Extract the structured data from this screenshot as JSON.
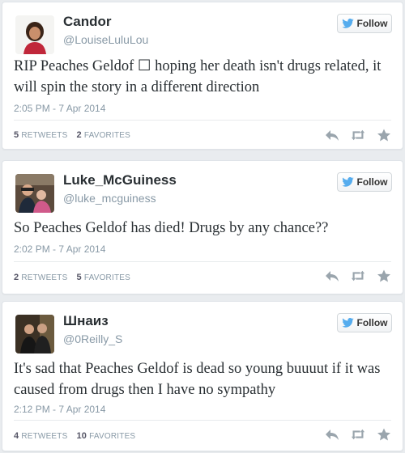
{
  "follow_label": "Follow",
  "stats_labels": {
    "retweets": "RETWEETS",
    "favorites": "FAVORITES"
  },
  "tweets": [
    {
      "display_name": "Candor",
      "screen_name": "@LouiseLuluLou",
      "text": "RIP Peaches Geldof ☐ hoping her death isn't drugs related, it will spin the story in a different direction",
      "timestamp": "2:05 PM - 7 Apr 2014",
      "retweets": "5",
      "favorites": "2"
    },
    {
      "display_name": "Luke_McGuiness",
      "screen_name": "@luke_mcguiness",
      "text": "So Peaches Geldof has died! Drugs by any chance??",
      "timestamp": "2:02 PM - 7 Apr 2014",
      "retweets": "2",
      "favorites": "5"
    },
    {
      "display_name": "Шнаиз",
      "screen_name": "@0Reilly_S",
      "text": "It's sad that Peaches Geldof is dead so young buuuut if it was caused from drugs then I have no sympathy",
      "timestamp": "2:12 PM - 7 Apr 2014",
      "retweets": "4",
      "favorites": "10"
    }
  ],
  "icons": {
    "follow": "twitter-bird-icon",
    "reply": "reply-icon",
    "retweet": "retweet-icon",
    "favorite": "star-icon"
  },
  "colors": {
    "twitter_blue": "#55acee",
    "text": "#292f33",
    "muted": "#8899a6",
    "action_icon": "#9aa5ad"
  }
}
